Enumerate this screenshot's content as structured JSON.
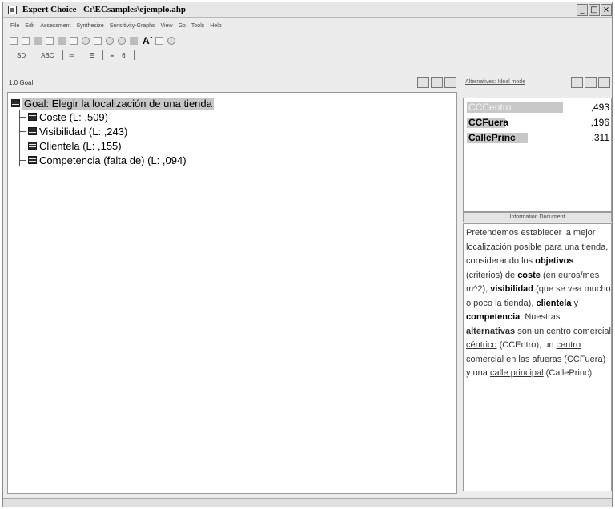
{
  "window": {
    "app_name": "Expert Choice",
    "file_path": "C:\\ECsamples\\ejemplo.ahp",
    "controls": {
      "minimize": "_",
      "maximize": "□",
      "close": "×"
    }
  },
  "menu": [
    "File",
    "Edit",
    "Assessment",
    "Synthesize",
    "Sensitivity-Graphs",
    "View",
    "Go",
    "Tools",
    "Help"
  ],
  "toolbar1": {
    "font_label": "Aˆ"
  },
  "toolbar2": {
    "items": [
      "SD",
      "ABC",
      "═",
      "☰",
      "≡",
      "6"
    ]
  },
  "tree_pane": {
    "header": "1.0 Goal",
    "goal": "Goal: Elegir la localización de una tienda",
    "children": [
      "Coste (L: ,509)",
      "Visibilidad (L: ,243)",
      "Clientela (L: ,155)",
      "Competencia (falta de) (L: ,094)"
    ]
  },
  "priorities_pane": {
    "header": "Alternatives: Ideal mode",
    "alternatives": [
      {
        "name": "CCCentro",
        "value": ",493",
        "priority": 0.493
      },
      {
        "name": "CCFuera",
        "value": ",196",
        "priority": 0.196
      },
      {
        "name": "CallePrinc",
        "value": ",311",
        "priority": 0.311
      }
    ]
  },
  "info_pane": {
    "header": "Information Document",
    "text": {
      "t1": "Pretendemos establecer la mejor localización posible para una tienda, considerando los ",
      "b1": "objetivos",
      "t2": " (criterios) de ",
      "b2": "coste",
      "t3": " (en euros/mes m^2), ",
      "b3": "visibilidad",
      "t4": " (que se vea mucho o poco la tienda), ",
      "b4": "clientela",
      "t5": " y ",
      "b5": "competencia",
      "t6": ". Nuestras ",
      "b6": "alternativas",
      "t7": " son un ",
      "u1": "centro comercial céntrico",
      "t8": " (CCEntro), un ",
      "u2": "centro comercial en las afueras",
      "t9": " (CCFuera) y una ",
      "u3": "calle principal",
      "t10": " (CallePrinc)"
    }
  },
  "colors": {
    "selection": "#c6c6c6",
    "window_bg": "#ececec",
    "pane_bg": "#ffffff"
  }
}
